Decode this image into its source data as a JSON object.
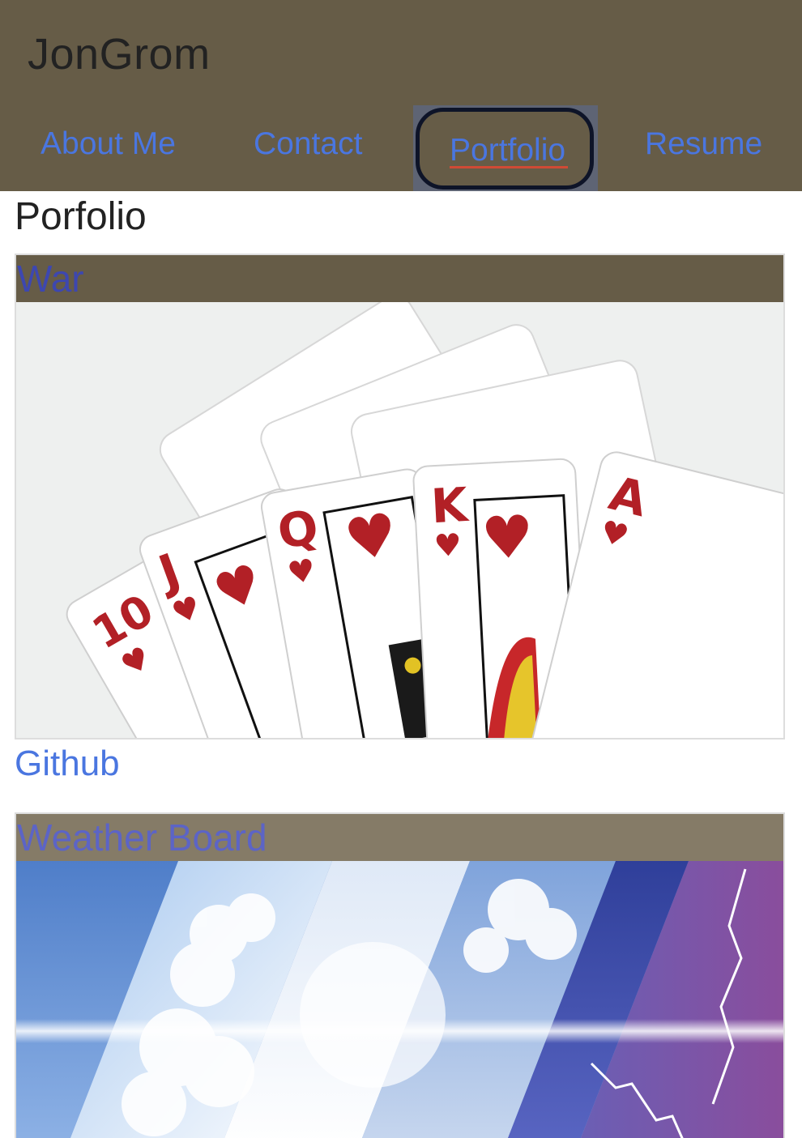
{
  "header": {
    "brand": "JonGrom",
    "nav": {
      "about": "About Me",
      "contact": "Contact",
      "portfolio": "Portfolio",
      "resume": "Resume"
    }
  },
  "page": {
    "title": "Porfolio"
  },
  "projects": [
    {
      "title": "War",
      "image": "playing-cards-royal-flush-hearts",
      "link_label": "Github"
    },
    {
      "title": "Weather Board",
      "image": "weather-sky-collage"
    }
  ],
  "colors": {
    "header_bg": "#665c47",
    "link": "#4a76e0",
    "active_underline": "#d04a35"
  }
}
